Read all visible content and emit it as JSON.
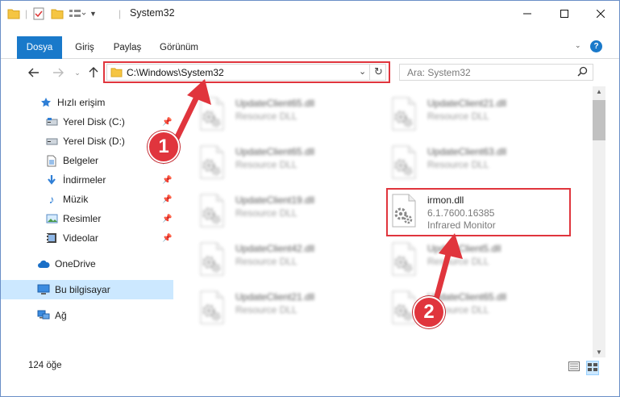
{
  "window": {
    "title": "System32"
  },
  "ribbon": {
    "tabs": [
      "Dosya",
      "Giriş",
      "Paylaş",
      "Görünüm"
    ]
  },
  "address": {
    "path": "C:\\Windows\\System32"
  },
  "search": {
    "placeholder": "Ara: System32"
  },
  "sidebar": {
    "items": [
      {
        "label": "Hızlı erişim",
        "icon": "star-icon"
      },
      {
        "label": "Yerel Disk (C:)",
        "icon": "drive-icon",
        "pinned": true
      },
      {
        "label": "Yerel Disk (D:)",
        "icon": "drive-icon",
        "pinned": true
      },
      {
        "label": "Belgeler",
        "icon": "document-icon",
        "pinned": true
      },
      {
        "label": "İndirmeler",
        "icon": "download-icon",
        "pinned": true
      },
      {
        "label": "Müzik",
        "icon": "music-icon",
        "pinned": true
      },
      {
        "label": "Resimler",
        "icon": "pictures-icon",
        "pinned": true
      },
      {
        "label": "Videolar",
        "icon": "video-icon",
        "pinned": true
      },
      {
        "label": "OneDrive",
        "icon": "cloud-icon"
      },
      {
        "label": "Bu bilgisayar",
        "icon": "computer-icon",
        "selected": true
      },
      {
        "label": "Ağ",
        "icon": "network-icon"
      }
    ]
  },
  "files": [
    {
      "name": "UpdateClient65.dll",
      "desc": "Resource DLL",
      "type": ""
    },
    {
      "name": "UpdateClient21.dll",
      "desc": "Resource DLL",
      "type": ""
    },
    {
      "name": "UpdateClient65.dll",
      "desc": "Resource DLL",
      "type": ""
    },
    {
      "name": "UpdateClient63.dll",
      "desc": "Resource DLL",
      "type": ""
    },
    {
      "name": "UpdateClient19.dll",
      "desc": "Resource DLL",
      "type": ""
    },
    {
      "name": "irmon.dll",
      "desc": "6.1.7600.16385",
      "type": "Infrared Monitor"
    },
    {
      "name": "UpdateClient42.dll",
      "desc": "Resource DLL",
      "type": ""
    },
    {
      "name": "UpdateClient5.dll",
      "desc": "Resource DLL",
      "type": ""
    },
    {
      "name": "UpdateClient21.dll",
      "desc": "Resource DLL",
      "type": ""
    },
    {
      "name": "UpdateClient65.dll",
      "desc": "Resource DLL",
      "type": ""
    }
  ],
  "status": {
    "count": "124 öğe"
  },
  "callouts": {
    "one": "1",
    "two": "2"
  },
  "colors": {
    "accent": "#1979ca",
    "highlight": "#e0353d",
    "selected": "#cce8ff"
  }
}
